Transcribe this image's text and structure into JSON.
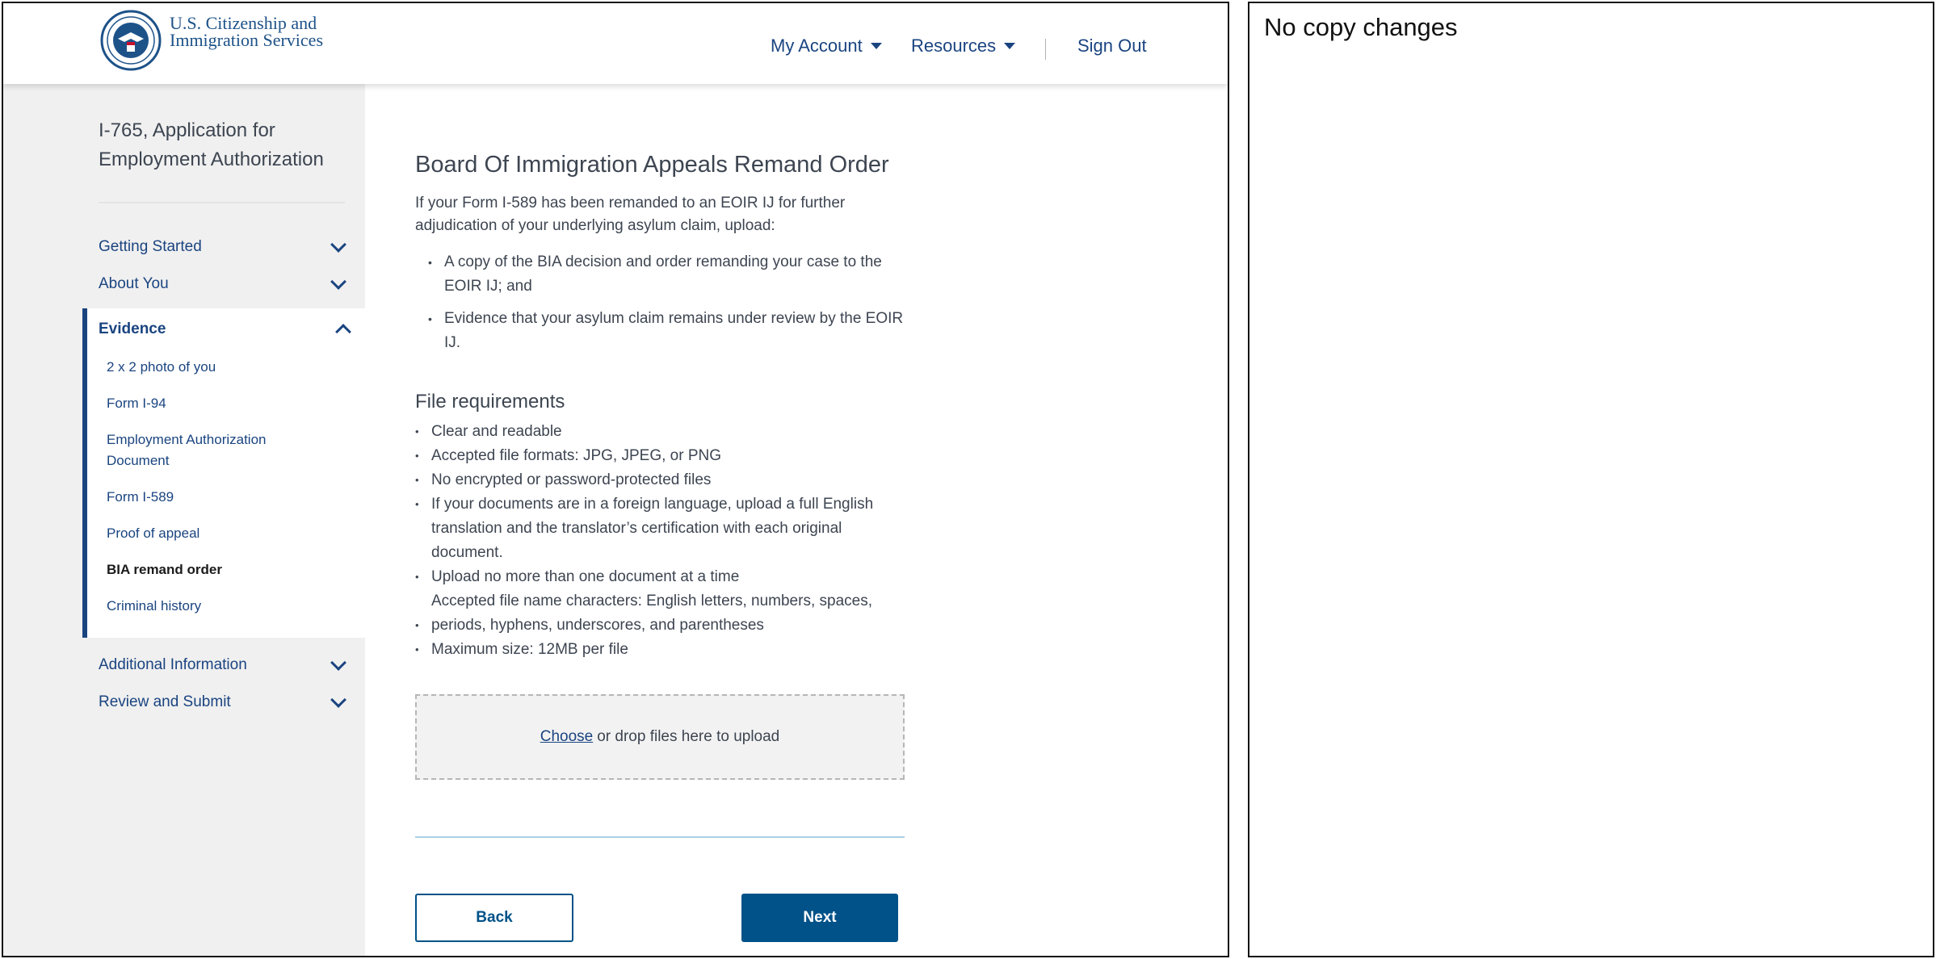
{
  "header": {
    "agency_name": "U.S. Citizenship and Immigration Services",
    "nav": {
      "my_account": "My Account",
      "resources": "Resources",
      "sign_out": "Sign Out"
    }
  },
  "sidebar": {
    "app_title": "I-765, Application for Employment Authorization",
    "sections": [
      {
        "label": "Getting Started"
      },
      {
        "label": "About You"
      },
      {
        "label": "Evidence"
      },
      {
        "label": "Additional Information"
      },
      {
        "label": "Review and Submit"
      }
    ],
    "evidence_items": [
      {
        "label": "2 x 2 photo of you"
      },
      {
        "label": "Form I-94"
      },
      {
        "label": "Employment Authorization Document"
      },
      {
        "label": "Form I-589"
      },
      {
        "label": "Proof of appeal"
      },
      {
        "label": "BIA remand order"
      },
      {
        "label": "Criminal history"
      }
    ]
  },
  "main": {
    "heading": "Board Of Immigration Appeals Remand Order",
    "intro": "If your Form I-589 has been remanded to an EOIR IJ for further adjudication of your underlying asylum claim, upload:",
    "upload_items": [
      "A copy of the BIA decision and order remanding your case to the EOIR IJ; and",
      "Evidence that your asylum claim remains under review by the EOIR IJ."
    ],
    "file_requirements_heading": "File requirements",
    "file_requirements": [
      "Clear and readable",
      "Accepted file formats: JPG, JPEG, or PNG",
      "No encrypted or password-protected files",
      "If your documents are in a foreign language,  upload a full English translation and the translator’s certification with each original document.",
      "Upload no more than one document at a time",
      "Accepted file name characters: English letters, numbers, spaces,",
      "periods, hyphens, underscores, and parentheses",
      "Maximum size: 12MB per file"
    ],
    "dropzone": {
      "choose": "Choose",
      "text": "or drop files here to upload"
    },
    "buttons": {
      "back": "Back",
      "next": "Next"
    }
  },
  "notes": {
    "text": "No copy changes"
  },
  "colors": {
    "primary": "#005288",
    "nav_text": "#1a4480",
    "sidebar_bg": "#f0f0f0",
    "body_text": "#3d4551"
  }
}
